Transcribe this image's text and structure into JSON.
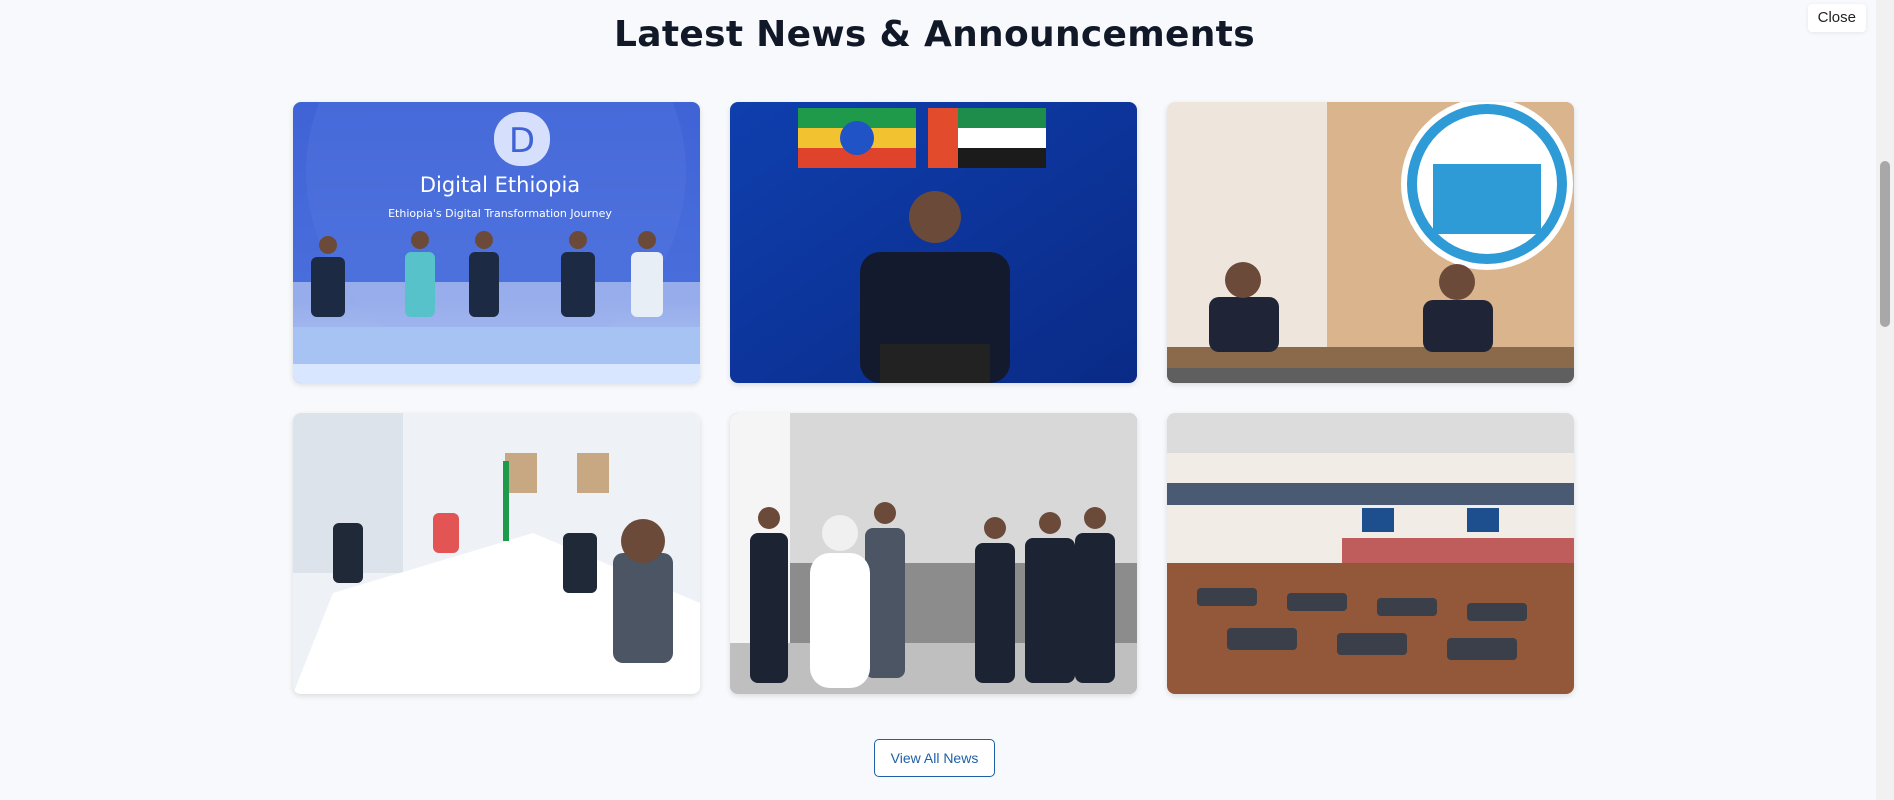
{
  "section": {
    "title": "Latest News & Announcements"
  },
  "close_button": {
    "label": "Close"
  },
  "news_cards": [
    {
      "logo_letter": "D",
      "banner_title": "Digital Ethiopia",
      "banner_subtitle": "Ethiopia's Digital Transformation Journey"
    },
    {},
    {},
    {},
    {},
    {}
  ],
  "view_all_button": {
    "label": "View All News"
  },
  "colors": {
    "accent": "#1f5fa8",
    "title_text": "#111827",
    "background": "#f7f9fc"
  }
}
